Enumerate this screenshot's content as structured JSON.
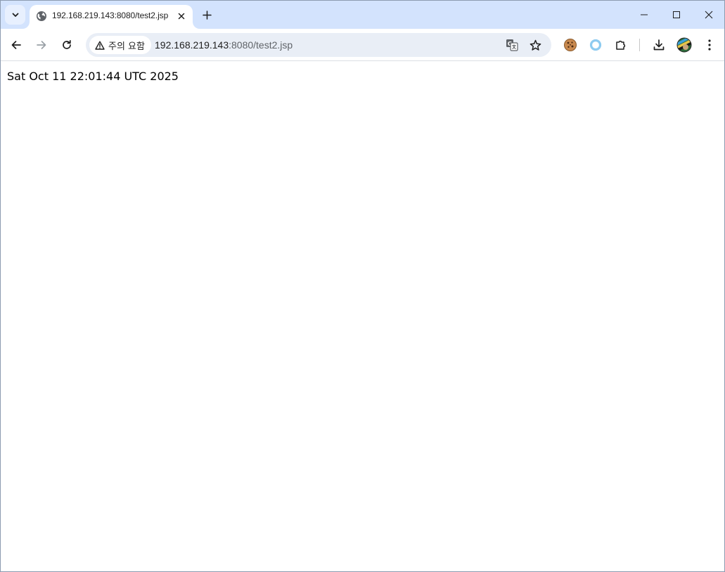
{
  "browser": {
    "tab": {
      "title": "192.168.219.143:8080/test2.jsp",
      "favicon": "globe-icon"
    },
    "toolbar": {
      "security_label": "주의 요함",
      "security_icon": "warning-triangle-icon",
      "url_host": "192.168.219.143",
      "url_rest": ":8080/test2.jsp"
    },
    "icons": {
      "tab_search": "chevron-down-icon",
      "new_tab": "plus-icon",
      "minimize": "minimize-icon",
      "maximize": "maximize-icon",
      "close": "close-icon",
      "back": "back-arrow-icon",
      "forward": "forward-arrow-icon",
      "reload": "reload-icon",
      "translate": "translate-icon",
      "bookmark": "star-icon",
      "extension_1": "cookie-icon",
      "extension_2": "ring-icon",
      "extensions": "puzzle-icon",
      "downloads": "download-icon",
      "profile": "avatar",
      "menu": "kebab-menu-icon"
    },
    "colors": {
      "tabstrip": "#d3e3fd",
      "omnibox": "#e9eef6",
      "ring": "#8ecbf0"
    }
  },
  "page": {
    "text": "Sat Oct 11 22:01:44 UTC 2025"
  }
}
